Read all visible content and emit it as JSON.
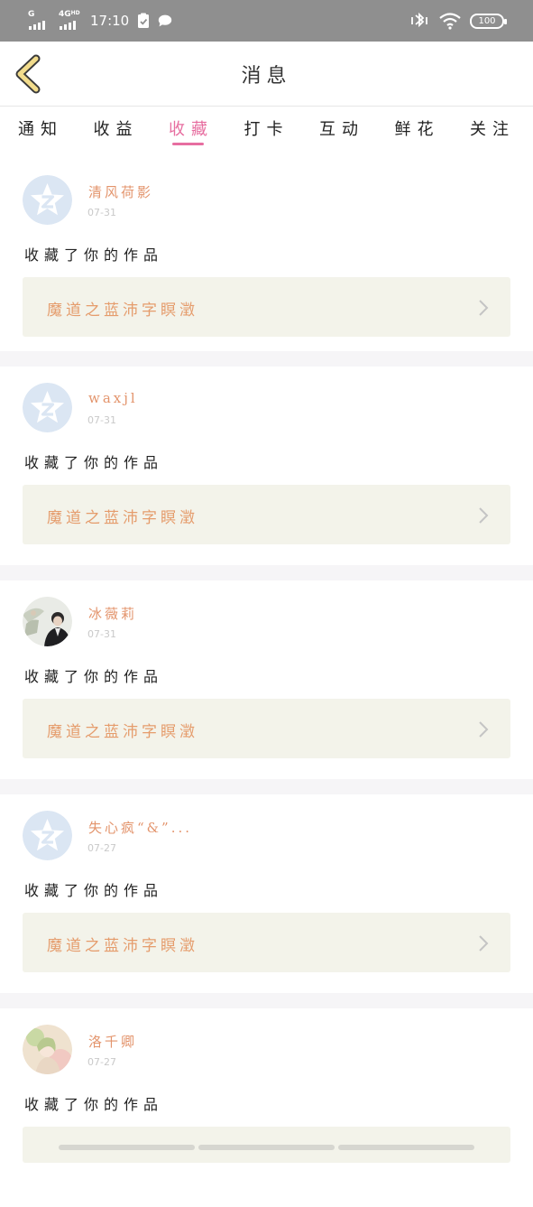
{
  "status_bar": {
    "sim1_label": "G",
    "sim2_label": "4G",
    "sim2_sup": "HD",
    "time": "17:10",
    "battery": "100"
  },
  "header": {
    "title": "消息"
  },
  "tabs": [
    {
      "label": "通知",
      "active": false
    },
    {
      "label": "收益",
      "active": false
    },
    {
      "label": "收藏",
      "active": true
    },
    {
      "label": "打卡",
      "active": false
    },
    {
      "label": "互动",
      "active": false
    },
    {
      "label": "鲜花",
      "active": false
    },
    {
      "label": "关注",
      "active": false
    }
  ],
  "items": [
    {
      "user": "清风荷影",
      "date": "07-31",
      "action": "收藏了你的作品",
      "work": "魔道之蓝沛字瞑澂",
      "avatar": "default-avatar"
    },
    {
      "user": "waxjl",
      "date": "07-31",
      "action": "收藏了你的作品",
      "work": "魔道之蓝沛字瞑澂",
      "avatar": "default-avatar"
    },
    {
      "user": "冰薇莉",
      "date": "07-31",
      "action": "收藏了你的作品",
      "work": "魔道之蓝沛字瞑澂",
      "avatar": "photo-avatar"
    },
    {
      "user": "失心疯“&”...",
      "date": "07-27",
      "action": "收藏了你的作品",
      "work": "魔道之蓝沛字瞑澂",
      "avatar": "default-avatar"
    },
    {
      "user": "洛千卿",
      "date": "07-27",
      "action": "收藏了你的作品",
      "work": "",
      "avatar": "illustration-avatar"
    }
  ],
  "colors": {
    "accent": "#e76ea0",
    "username": "#e3946c",
    "work_title": "#e59c6c",
    "work_bg": "#f3f3ea",
    "back_arrow": "#f2dc8c"
  }
}
